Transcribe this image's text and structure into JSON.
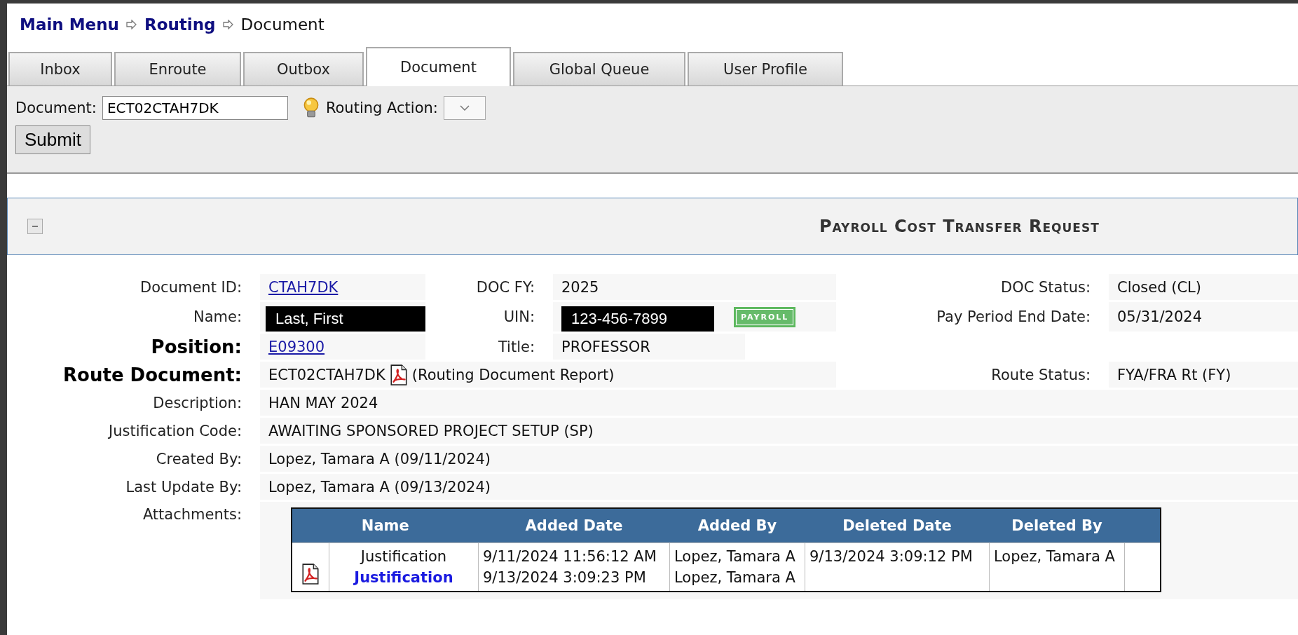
{
  "breadcrumb": [
    {
      "label": "Main Menu",
      "link": true
    },
    {
      "label": "Routing",
      "link": true
    },
    {
      "label": "Document",
      "link": false
    }
  ],
  "tabs": [
    {
      "label": "Inbox",
      "selected": false
    },
    {
      "label": "Enroute",
      "selected": false
    },
    {
      "label": "Outbox",
      "selected": false
    },
    {
      "label": "Document",
      "selected": true
    },
    {
      "label": "Global Queue",
      "selected": false
    },
    {
      "label": "User Profile",
      "selected": false
    }
  ],
  "toolbar": {
    "document_label": "Document:",
    "document_value": "ECT02CTAH7DK",
    "routing_action_label": "Routing Action:",
    "submit": "Submit"
  },
  "section": {
    "title": "Payroll Cost Transfer Request",
    "expanded": true
  },
  "header_fields": {
    "document_id": {
      "label": "Document ID:",
      "value": "CTAH7DK"
    },
    "doc_fy": {
      "label": "DOC FY:",
      "value": "2025"
    },
    "doc_status": {
      "label": "DOC Status:",
      "value": "Closed (CL)"
    },
    "name": {
      "label": "Name:",
      "value": "Last, First"
    },
    "uin": {
      "label": "UIN:",
      "value": "123-456-7899"
    },
    "badge": "PAYROLL",
    "pay_period_end_date": {
      "label": "Pay Period End Date:",
      "value": "05/31/2024"
    },
    "position": {
      "label": "Position:",
      "value": "E09300",
      "emphasis": true
    },
    "title": {
      "label": "Title:",
      "value": "PROFESSOR"
    },
    "route_document": {
      "label": "Route Document:",
      "value": "ECT02CTAH7DK",
      "report": "(Routing Document Report)",
      "emphasis": true
    },
    "route_status": {
      "label": "Route Status:",
      "value": "FYA/FRA Rt (FY)"
    }
  },
  "detail_fields": [
    {
      "label": "Description:",
      "value": "HAN MAY 2024"
    },
    {
      "label": "Justification Code:",
      "value": "AWAITING SPONSORED PROJECT SETUP (SP)"
    },
    {
      "label": "Created By:",
      "value": "Lopez, Tamara A (09/11/2024)"
    },
    {
      "label": "Last Update By:",
      "value": "Lopez, Tamara A (09/13/2024)"
    }
  ],
  "attachments": {
    "label": "Attachments:",
    "columns": [
      "Name",
      "Added Date",
      "Added By",
      "Deleted Date",
      "Deleted By"
    ],
    "rows": [
      {
        "name": "Justification",
        "link": "Justification",
        "added_date": [
          "9/11/2024 11:56:12 AM",
          "9/13/2024 3:09:23 PM"
        ],
        "added_by": [
          "Lopez, Tamara A",
          "Lopez, Tamara A"
        ],
        "deleted_date": [
          "9/13/2024 3:09:12 PM"
        ],
        "deleted_by": [
          "Lopez, Tamara A"
        ]
      }
    ]
  }
}
